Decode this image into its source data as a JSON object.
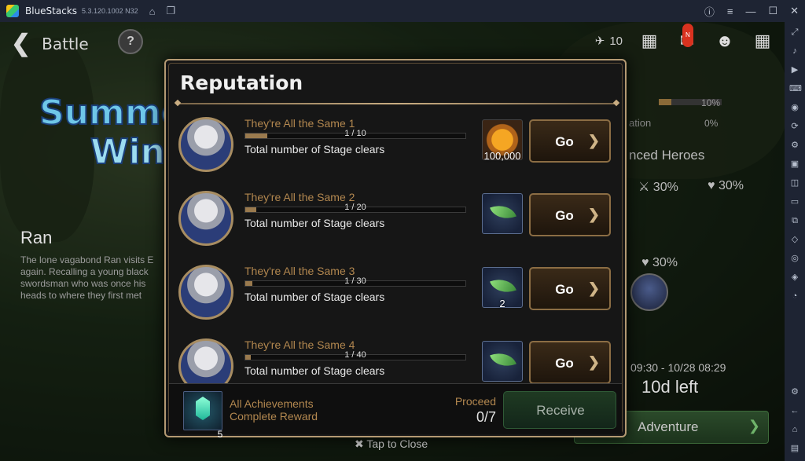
{
  "window": {
    "app_name": "BlueStacks",
    "version": "5.3.120.1002 N32"
  },
  "titlebar_icons": [
    "home-icon",
    "multi-instance-icon"
  ],
  "titlebar_controls": [
    "help-icon",
    "menu-icon",
    "minimize-icon",
    "maximize-icon",
    "close-icon"
  ],
  "sidebar_icons": [
    "fullscreen-icon",
    "volume-icon",
    "video-icon",
    "keyboard-icon",
    "record-icon",
    "replay-icon",
    "macro-icon",
    "apk-icon",
    "screenshot-icon",
    "folder-icon",
    "resize-icon",
    "eco-icon",
    "location-icon",
    "layers-icon",
    "time-icon",
    "settings-icon",
    "back-icon",
    "home-icon",
    "recent-apps-icon"
  ],
  "game": {
    "nav_title": "Battle",
    "help_label": "?",
    "stamina": "10",
    "mail_badge": "N",
    "event_logo_line1": "Summe",
    "event_logo_line2": "Wint",
    "event_hero_name": "Ran",
    "event_description": "The lone vagabond Ran visits E again. Recalling a young black swordsman who was once his heads to where they first met",
    "stats": [
      {
        "pct": "10%",
        "fill": 0.2
      },
      {
        "label": "ation",
        "pct": "0%",
        "fill": 0
      }
    ],
    "heroes_title": "nced Heroes",
    "bonus_attack": "30%",
    "bonus_health_1": "30%",
    "bonus_health_2": "30%",
    "date_range": "09:30 - 10/28 08:29",
    "time_left": "10d left",
    "adventure_label": "Adventure",
    "tap_to_close": "Tap to Close"
  },
  "modal": {
    "title": "Reputation",
    "quests": [
      {
        "title": "They're All the Same 1",
        "progress": "1 / 10",
        "fill": 0.1,
        "description": "Total number of Stage clears",
        "reward_type": "gold",
        "reward_count": "100,000",
        "button": "Go"
      },
      {
        "title": "They're All the Same 2",
        "progress": "1 / 20",
        "fill": 0.05,
        "description": "Total number of Stage clears",
        "reward_type": "leaf",
        "reward_count": "",
        "button": "Go"
      },
      {
        "title": "They're All the Same 3",
        "progress": "1 / 30",
        "fill": 0.033,
        "description": "Total number of Stage clears",
        "reward_type": "leaf",
        "reward_count": "2",
        "button": "Go"
      },
      {
        "title": "They're All the Same 4",
        "progress": "1 / 40",
        "fill": 0.025,
        "description": "Total number of Stage clears",
        "reward_type": "leaf",
        "reward_count": "",
        "button": "Go"
      }
    ],
    "footer": {
      "item_count": "5",
      "text_line1": "All Achievements",
      "text_line2": "Complete Reward",
      "proceed_label": "Proceed",
      "proceed_value": "0/7",
      "receive_label": "Receive"
    }
  }
}
